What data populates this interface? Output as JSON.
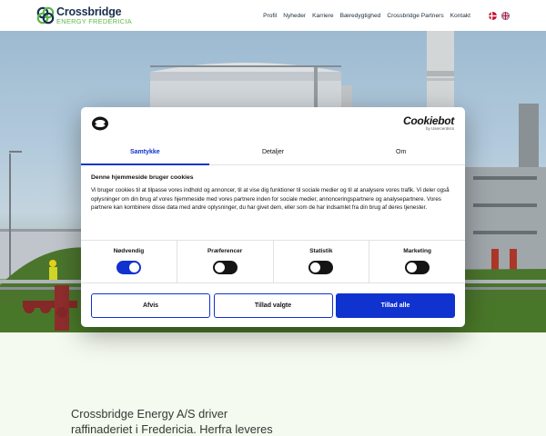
{
  "header": {
    "logo": {
      "name": "Crossbridge",
      "sub": "ENERGY FREDERICIA"
    },
    "nav": [
      "Profil",
      "Nyheder",
      "Karriere",
      "Bæredygtighed",
      "Crossbridge Partners",
      "Kontakt"
    ],
    "languages": [
      {
        "code": "da",
        "icon": "danish-flag-icon"
      },
      {
        "code": "en",
        "icon": "uk-flag-icon"
      }
    ]
  },
  "cookie": {
    "brand": "Cookiebot",
    "brand_by": "by Usercentrics",
    "tabs": [
      "Samtykke",
      "Detaljer",
      "Om"
    ],
    "active_tab": 0,
    "heading": "Denne hjemmeside bruger cookies",
    "body": "Vi bruger cookies til at tilpasse vores indhold og annoncer, til at vise dig funktioner til sociale medier og til at analysere vores trafik. Vi deler også oplysninger om din brug af vores hjemmeside med vores partnere inden for sociale medier, annonceringspartnere og analysepartnere. Vores partnere kan kombinere disse data med andre oplysninger, du har givet dem, eller som de har indsamlet fra din brug af deres tjenester.",
    "toggles": [
      {
        "label": "Nødvendig",
        "on": true
      },
      {
        "label": "Præferencer",
        "on": false
      },
      {
        "label": "Statistik",
        "on": false
      },
      {
        "label": "Marketing",
        "on": false
      }
    ],
    "buttons": {
      "reject": "Afvis",
      "allow_selected": "Tillad valgte",
      "allow_all": "Tillad alle"
    }
  },
  "intro": {
    "text_line1": "Crossbridge Energy A/S driver",
    "text_line2": "raffinaderiet i Fredericia. Herfra leveres"
  },
  "colors": {
    "accent": "#1032cf",
    "brand_navy": "#1a2f4f",
    "brand_green": "#5bb94a",
    "page_bg": "#f4faef"
  }
}
